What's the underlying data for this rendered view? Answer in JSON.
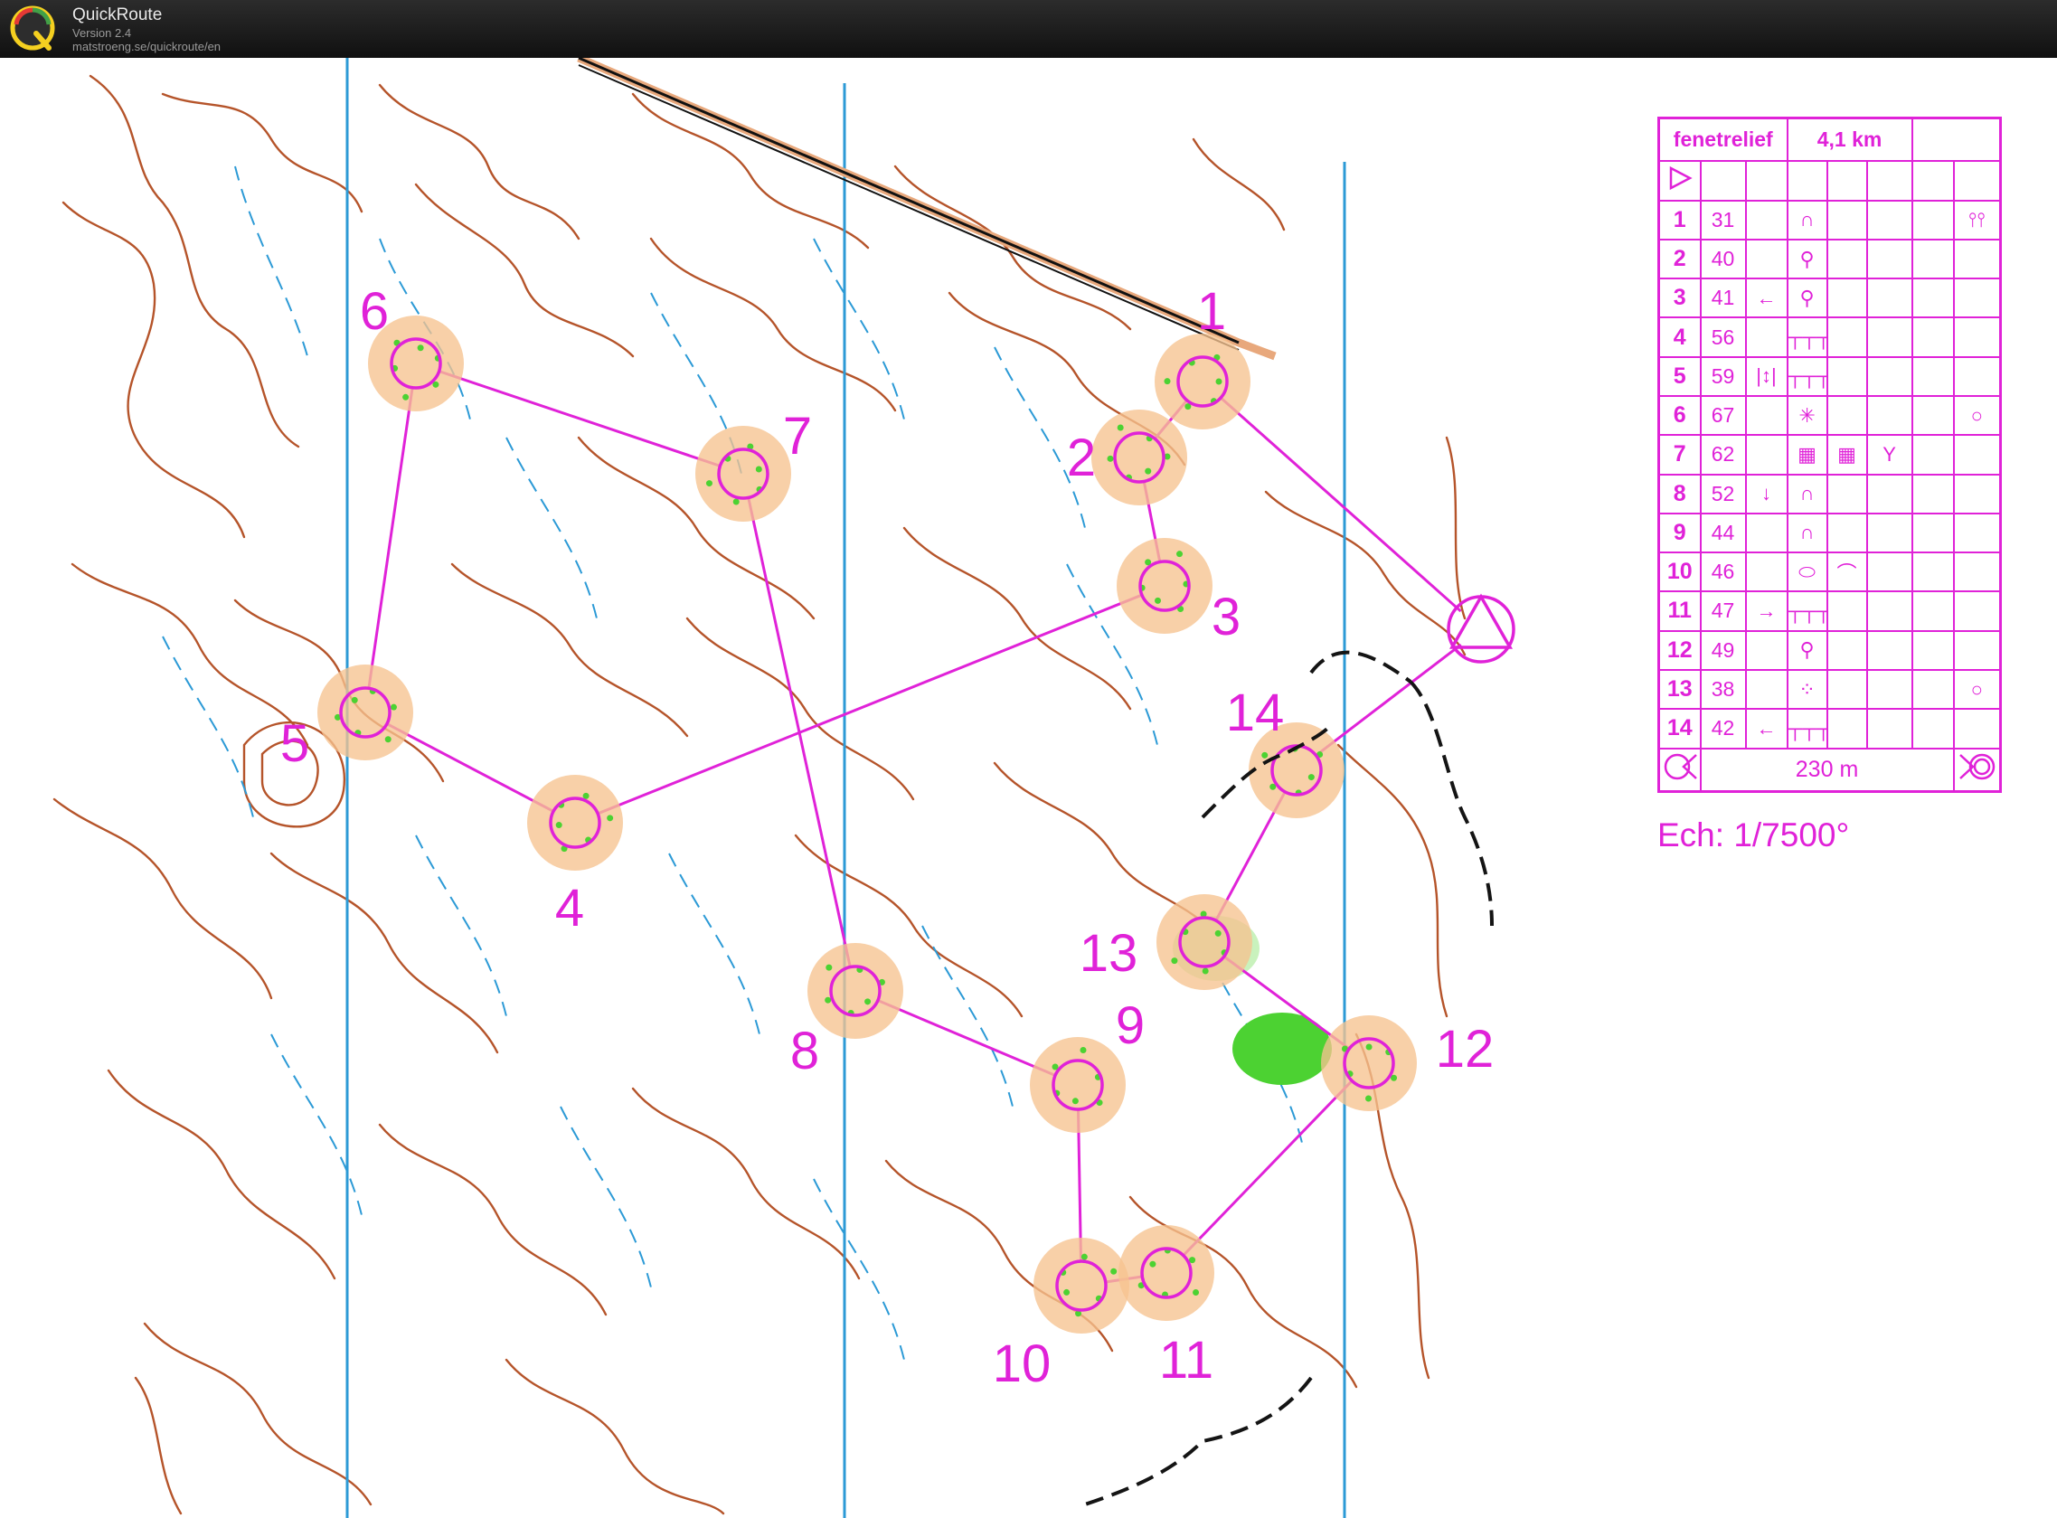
{
  "app": {
    "title": "QuickRoute",
    "version": "Version 2.4",
    "url": "matstroeng.se/quickroute/en"
  },
  "colors": {
    "course": "#e022d8",
    "contour": "#b5542a",
    "water": "#2c9ad6",
    "circle_fill": "#f6c390",
    "vegetation": "#4cd232",
    "track": "#141414"
  },
  "controls": [
    {
      "label": "1",
      "code": "31"
    },
    {
      "label": "2",
      "code": "40"
    },
    {
      "label": "3",
      "code": "41"
    },
    {
      "label": "4",
      "code": "56"
    },
    {
      "label": "5",
      "code": "59"
    },
    {
      "label": "6",
      "code": "67"
    },
    {
      "label": "7",
      "code": "62"
    },
    {
      "label": "8",
      "code": "52"
    },
    {
      "label": "9",
      "code": "44"
    },
    {
      "label": "10",
      "code": "46"
    },
    {
      "label": "11",
      "code": "47"
    },
    {
      "label": "12",
      "code": "49"
    },
    {
      "label": "13",
      "code": "38"
    },
    {
      "label": "14",
      "code": "42"
    }
  ],
  "description_sheet": {
    "event": "fenetrelief",
    "length": "4,1 km",
    "finish_distance": "230 m",
    "rows": [
      {
        "num": "1",
        "code": "31",
        "c": "",
        "d": "∩",
        "e": "",
        "f": "",
        "g": "",
        "h": "⫯⫯"
      },
      {
        "num": "2",
        "code": "40",
        "c": "",
        "d": "⚲",
        "e": "",
        "f": "",
        "g": "",
        "h": ""
      },
      {
        "num": "3",
        "code": "41",
        "c": "←",
        "d": "⚲",
        "e": "",
        "f": "",
        "g": "",
        "h": ""
      },
      {
        "num": "4",
        "code": "56",
        "c": "",
        "d": "┬┬┬",
        "e": "",
        "f": "",
        "g": "",
        "h": ""
      },
      {
        "num": "5",
        "code": "59",
        "c": "|↕|",
        "d": "┬┬┬",
        "e": "",
        "f": "",
        "g": "",
        "h": ""
      },
      {
        "num": "6",
        "code": "67",
        "c": "",
        "d": "✳",
        "e": "",
        "f": "",
        "g": "",
        "h": "○"
      },
      {
        "num": "7",
        "code": "62",
        "c": "",
        "d": "▦",
        "e": "▦",
        "f": "Y",
        "g": "",
        "h": ""
      },
      {
        "num": "8",
        "code": "52",
        "c": "↓",
        "d": "∩",
        "e": "",
        "f": "",
        "g": "",
        "h": ""
      },
      {
        "num": "9",
        "code": "44",
        "c": "",
        "d": "∩",
        "e": "",
        "f": "",
        "g": "",
        "h": ""
      },
      {
        "num": "10",
        "code": "46",
        "c": "",
        "d": "⬭",
        "e": "⌒",
        "f": "",
        "g": "",
        "h": ""
      },
      {
        "num": "11",
        "code": "47",
        "c": "→",
        "d": "┬┬┬",
        "e": "",
        "f": "",
        "g": "",
        "h": ""
      },
      {
        "num": "12",
        "code": "49",
        "c": "",
        "d": "⚲",
        "e": "",
        "f": "",
        "g": "",
        "h": ""
      },
      {
        "num": "13",
        "code": "38",
        "c": "",
        "d": "⁘",
        "e": "",
        "f": "",
        "g": "",
        "h": "○"
      },
      {
        "num": "14",
        "code": "42",
        "c": "←",
        "d": "┬┬┬",
        "e": "",
        "f": "",
        "g": "",
        "h": ""
      }
    ]
  },
  "scale_text": "Ech: 1/7500°",
  "icons": {
    "start": "start-triangle-icon",
    "finish_left": "finish-funnel-icon",
    "finish_right": "finish-circle-icon"
  }
}
